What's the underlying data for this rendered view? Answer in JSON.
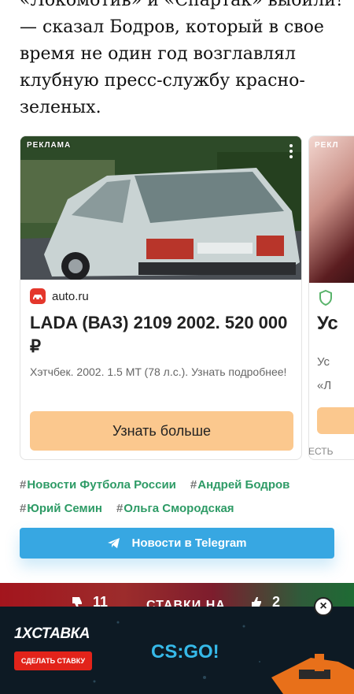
{
  "article": {
    "cut_line": "«Локомотив» и «Спартак» выбили!",
    "lines": [
      "— сказал Бодров, который в свое",
      "время не один год возглавлял",
      "клубную пресс-службу красно-",
      "зеленых."
    ]
  },
  "ad_main": {
    "tag": "РЕКЛАМА",
    "source": "auto.ru",
    "title": "LADA (ВАЗ) 2109 2002. 520 000 ₽",
    "description": "Хэтчбек. 2002. 1.5 MT (78 л.с.). Узнать подробнее!",
    "cta": "Узнать больше",
    "menu_icon": "more-vertical-icon"
  },
  "ad_next": {
    "tag": "РЕКЛ",
    "title": "Ус",
    "desc_line1": "Ус",
    "desc_line2": "«Л",
    "footer": "ЕСТЬ"
  },
  "tags": {
    "hash": "#",
    "row1": [
      "Новости Футбола России",
      "Андрей Бодров"
    ],
    "row2": [
      "Юрий Семин",
      "Ольга Смородская"
    ]
  },
  "telegram": {
    "label": "Новости в Telegram",
    "icon": "telegram-plane-icon"
  },
  "vote": {
    "dislike_count": "11",
    "like_count": "2",
    "middle": "СТАВКИ НА"
  },
  "bet": {
    "logo_prefix": "1X",
    "logo_rest": "СТАВКА",
    "cta": "СДЕЛАТЬ СТАВКУ",
    "game": "CS:GO!",
    "close": "×"
  },
  "colors": {
    "tag_green": "#2e9b66",
    "cta_orange": "#fbc88e",
    "telegram_blue": "#37a7e2",
    "bet_red": "#e2231a",
    "csgo_blue": "#36b9e8"
  }
}
